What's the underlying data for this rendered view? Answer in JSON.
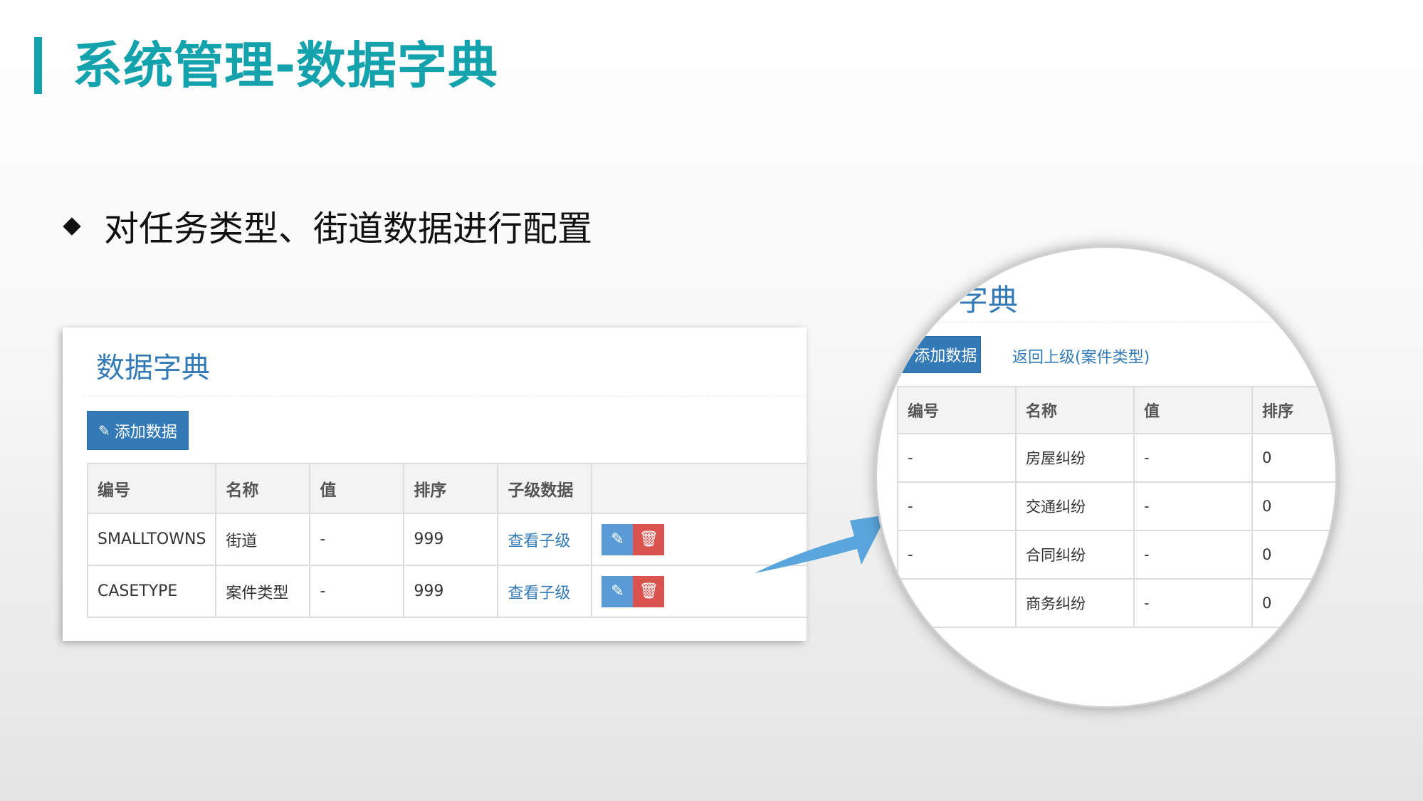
{
  "slide": {
    "title": "系统管理-数据字典",
    "bullet": "对任务类型、街道数据进行配置"
  },
  "panel": {
    "title": "数据字典",
    "add_label": "添加数据",
    "columns": [
      "编号",
      "名称",
      "值",
      "排序",
      "子级数据",
      ""
    ],
    "rows": [
      {
        "code": "SMALLTOWNS",
        "name": "街道",
        "value": "-",
        "order": "999",
        "child": "查看子级"
      },
      {
        "code": "CASETYPE",
        "name": "案件类型",
        "value": "-",
        "order": "999",
        "child": "查看子级"
      }
    ]
  },
  "zoom": {
    "title_fragment": "字典",
    "add_label": "添加数据",
    "back_label": "返回上级(案件类型)",
    "columns": [
      "编号",
      "名称",
      "值",
      "排序"
    ],
    "rows": [
      {
        "code": "-",
        "name": "房屋纠纷",
        "value": "-",
        "order": "0"
      },
      {
        "code": "-",
        "name": "交通纠纷",
        "value": "-",
        "order": "0"
      },
      {
        "code": "-",
        "name": "合同纠纷",
        "value": "-",
        "order": "0"
      },
      {
        "code": "",
        "name": "商务纠纷",
        "value": "-",
        "order": "0"
      }
    ]
  },
  "icons": {
    "add": "edit-square-icon",
    "edit": "pencil-icon",
    "delete": "trash-icon"
  },
  "colors": {
    "accent": "#14a3ad",
    "primary": "#337ab7",
    "danger": "#d9534f",
    "arrow": "#5aa6dc"
  }
}
